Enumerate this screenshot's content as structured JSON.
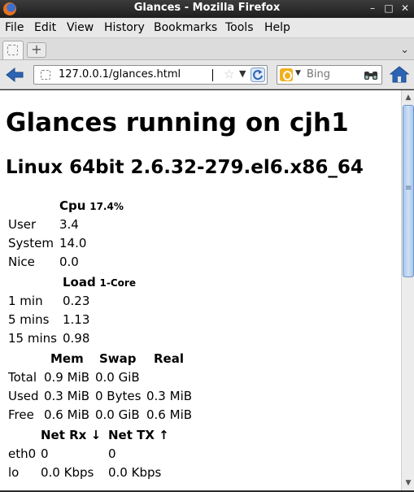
{
  "window": {
    "title": "Glances - Mozilla Firefox",
    "minimize": "–",
    "maximize": "□",
    "close": "✕"
  },
  "menu": {
    "items": [
      {
        "label": "File"
      },
      {
        "label": "Edit"
      },
      {
        "label": "View"
      },
      {
        "label": "History"
      },
      {
        "label": "Bookmarks"
      },
      {
        "label": "Tools"
      },
      {
        "label": "Help"
      }
    ]
  },
  "tabs": {
    "new_tab": "+",
    "list": "⌄"
  },
  "navigation": {
    "url": "127.0.0.1/glances.html",
    "search_placeholder": "Bing",
    "star": "☆",
    "dropdown": "▼",
    "engine_dropdown": "▼"
  },
  "page": {
    "heading": "Glances running on cjh1",
    "subheading": "Linux 64bit 2.6.32-279.el6.x86_64",
    "cpu": {
      "title": "Cpu",
      "total": "17.4%",
      "rows": [
        {
          "label": "User",
          "value": "3.4"
        },
        {
          "label": "System",
          "value": "14.0"
        },
        {
          "label": "Nice",
          "value": "0.0"
        }
      ]
    },
    "load": {
      "title": "Load",
      "cores": "1-Core",
      "rows": [
        {
          "label": "1 min",
          "value": "0.23"
        },
        {
          "label": "5 mins",
          "value": "1.13"
        },
        {
          "label": "15 mins",
          "value": "0.98"
        }
      ]
    },
    "memory": {
      "headers": [
        "Mem",
        "Swap",
        "Real"
      ],
      "rows": [
        {
          "label": "Total",
          "mem": "0.9 MiB",
          "swap": "0.0 GiB",
          "real": ""
        },
        {
          "label": "Used",
          "mem": "0.3 MiB",
          "swap": "0 Bytes",
          "real": "0.3 MiB"
        },
        {
          "label": "Free",
          "mem": "0.6 MiB",
          "swap": "0.0 GiB",
          "real": "0.6 MiB"
        }
      ]
    },
    "network": {
      "headers": [
        "Net Rx ↓",
        "Net TX ↑"
      ],
      "rows": [
        {
          "label": "eth0",
          "rx": "0",
          "tx": "0"
        },
        {
          "label": "lo",
          "rx": "0.0 Kbps",
          "tx": "0.0 Kbps"
        }
      ]
    }
  },
  "scrollbar": {
    "up": "▲",
    "down": "▼"
  }
}
